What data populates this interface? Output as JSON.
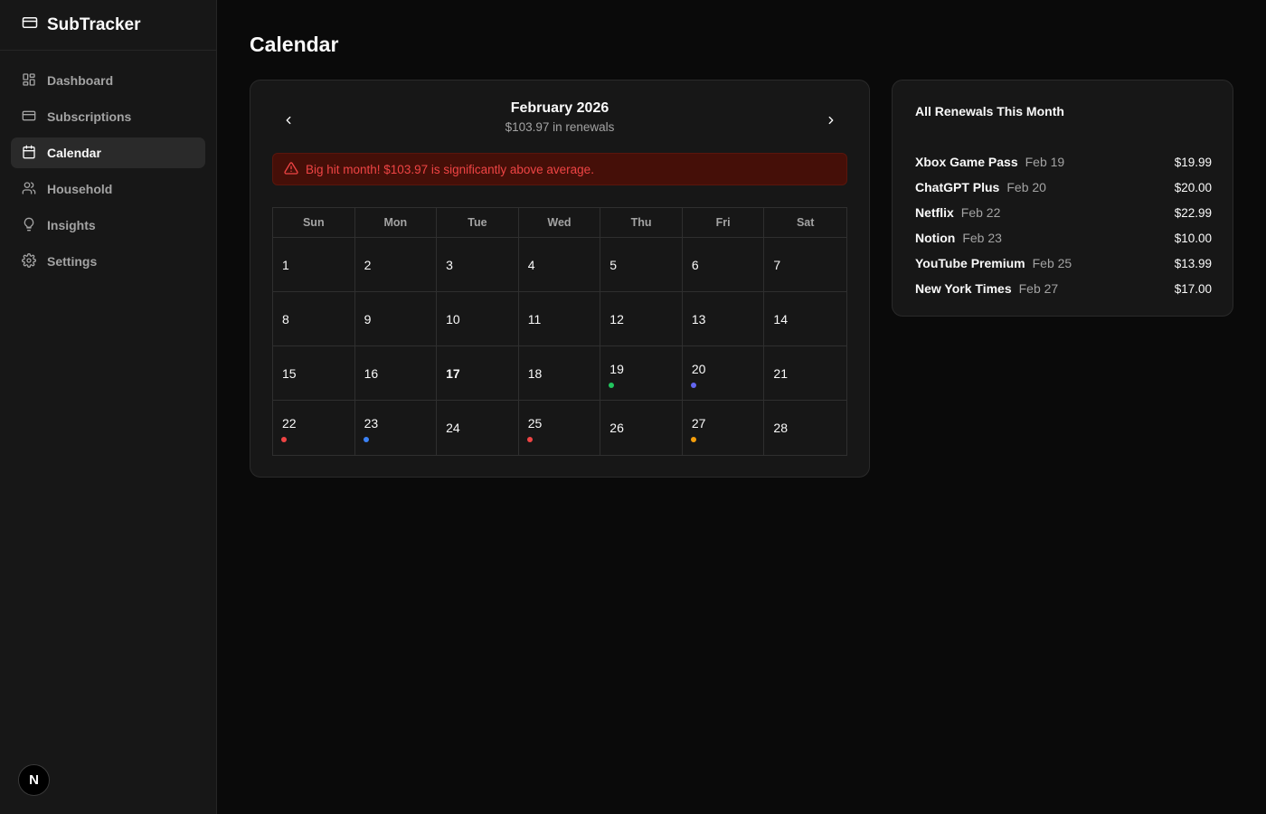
{
  "app": {
    "name": "SubTracker"
  },
  "sidebar": {
    "items": [
      {
        "label": "Dashboard",
        "icon": "dashboard-grid-icon"
      },
      {
        "label": "Subscriptions",
        "icon": "credit-card-icon"
      },
      {
        "label": "Calendar",
        "icon": "calendar-icon",
        "active": true
      },
      {
        "label": "Household",
        "icon": "users-icon"
      },
      {
        "label": "Insights",
        "icon": "lightbulb-icon"
      },
      {
        "label": "Settings",
        "icon": "gear-icon"
      }
    ],
    "badge": "N"
  },
  "page": {
    "title": "Calendar"
  },
  "calendar": {
    "month": "February 2026",
    "subtitle": "$103.97 in renewals",
    "alert": "Big hit month! $103.97 is significantly above average.",
    "weekdays": [
      "Sun",
      "Mon",
      "Tue",
      "Wed",
      "Thu",
      "Fri",
      "Sat"
    ],
    "days": [
      {
        "d": "1"
      },
      {
        "d": "2"
      },
      {
        "d": "3"
      },
      {
        "d": "4"
      },
      {
        "d": "5"
      },
      {
        "d": "6"
      },
      {
        "d": "7"
      },
      {
        "d": "8"
      },
      {
        "d": "9"
      },
      {
        "d": "10"
      },
      {
        "d": "11"
      },
      {
        "d": "12"
      },
      {
        "d": "13"
      },
      {
        "d": "14"
      },
      {
        "d": "15"
      },
      {
        "d": "16"
      },
      {
        "d": "17",
        "today": true
      },
      {
        "d": "18"
      },
      {
        "d": "19",
        "dot": "#22c55e"
      },
      {
        "d": "20",
        "dot": "#6366f1"
      },
      {
        "d": "21"
      },
      {
        "d": "22",
        "dot": "#ef4444"
      },
      {
        "d": "23",
        "dot": "#3b82f6"
      },
      {
        "d": "24"
      },
      {
        "d": "25",
        "dot": "#ef4444"
      },
      {
        "d": "26"
      },
      {
        "d": "27",
        "dot": "#f59e0b"
      },
      {
        "d": "28"
      }
    ]
  },
  "renewals": {
    "title": "All Renewals This Month",
    "items": [
      {
        "name": "Xbox Game Pass",
        "date": "Feb 19",
        "amount": "$19.99"
      },
      {
        "name": "ChatGPT Plus",
        "date": "Feb 20",
        "amount": "$20.00"
      },
      {
        "name": "Netflix",
        "date": "Feb 22",
        "amount": "$22.99"
      },
      {
        "name": "Notion",
        "date": "Feb 23",
        "amount": "$10.00"
      },
      {
        "name": "YouTube Premium",
        "date": "Feb 25",
        "amount": "$13.99"
      },
      {
        "name": "New York Times",
        "date": "Feb 27",
        "amount": "$17.00"
      }
    ]
  }
}
